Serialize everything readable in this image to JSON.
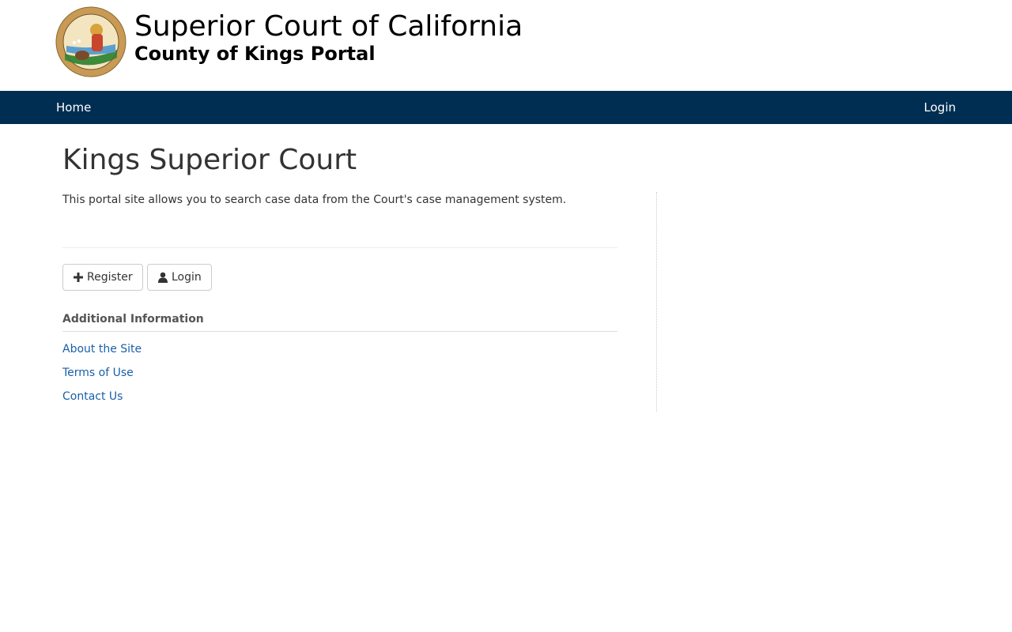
{
  "header": {
    "title": "Superior Court of California",
    "subtitle": "County of Kings Portal",
    "seal_icon": "california-seal-icon",
    "seal_ring_text_top": "THE GREAT SEAL OF THE STATE OF",
    "seal_ring_text_bottom": "CALIFORNIA",
    "seal_motto": "EUREKA"
  },
  "nav": {
    "home_label": "Home",
    "login_label": "Login",
    "background_color": "#002e52"
  },
  "main": {
    "heading": "Kings Superior Court",
    "intro": "This portal site allows you to search case data from the Court's case management system.",
    "buttons": {
      "register_label": "Register",
      "register_icon": "plus-icon",
      "login_label": "Login",
      "login_icon": "user-icon"
    },
    "additional_info": {
      "heading": "Additional Information",
      "links": [
        {
          "label": "About the Site"
        },
        {
          "label": "Terms of Use"
        },
        {
          "label": "Contact Us"
        }
      ]
    }
  },
  "colors": {
    "link": "#1a5fa8",
    "text": "#333333"
  }
}
